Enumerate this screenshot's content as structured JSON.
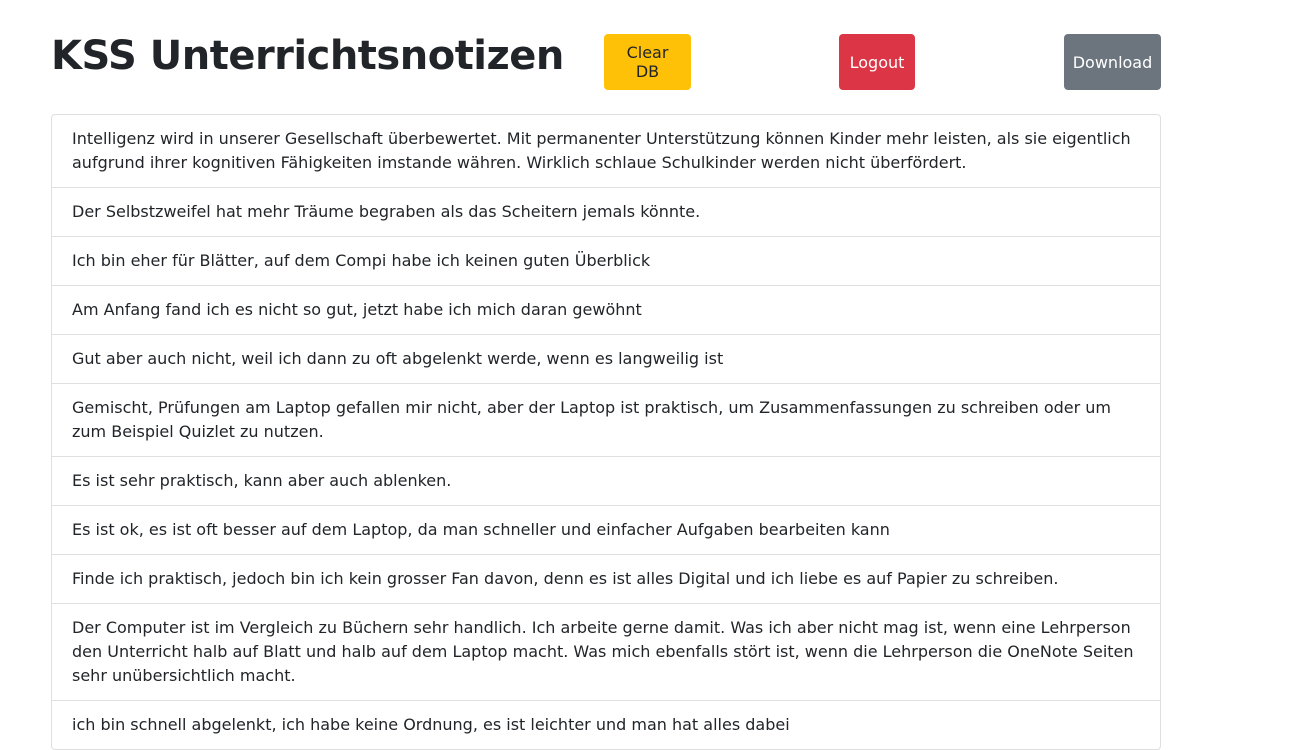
{
  "header": {
    "title": "KSS Unterrichtsnotizen",
    "clear_label": "Clear DB",
    "logout_label": "Logout",
    "download_label": "Download"
  },
  "colors": {
    "warning": "#ffc107",
    "danger": "#dc3545",
    "secondary": "#6c757d"
  },
  "notes": [
    "Intelligenz wird in unserer Gesellschaft überbewertet. Mit permanenter Unterstützung können Kinder mehr leisten, als sie eigentlich aufgrund ihrer kognitiven Fähigkeiten imstande währen. Wirklich schlaue Schulkinder werden nicht überfördert.",
    "Der Selbstzweifel hat mehr Träume begraben als das Scheitern jemals könnte.",
    "Ich bin eher für Blätter, auf dem Compi habe ich keinen guten Überblick",
    "Am Anfang fand ich es nicht so gut, jetzt habe ich mich daran gewöhnt",
    "Gut aber auch nicht, weil ich dann zu oft abgelenkt werde, wenn es langweilig ist",
    "Gemischt, Prüfungen am Laptop gefallen mir nicht, aber der Laptop ist praktisch, um Zusammenfassungen zu schreiben oder um zum Beispiel Quizlet zu nutzen.",
    "Es ist sehr praktisch, kann aber auch ablenken.",
    "Es ist ok, es ist oft besser auf dem Laptop, da man schneller und einfacher Aufgaben bearbeiten kann",
    "Finde ich praktisch, jedoch bin ich kein grosser Fan davon, denn es ist alles Digital und ich liebe es auf Papier zu schreiben.",
    "Der Computer ist im Vergleich zu Büchern sehr handlich. Ich arbeite gerne damit. Was ich aber nicht mag ist, wenn eine Lehrperson den Unterricht halb auf Blatt und halb auf dem Laptop macht. Was mich ebenfalls stört ist, wenn die Lehrperson die OneNote Seiten sehr unübersichtlich macht.",
    "ich bin schnell abgelenkt, ich habe keine Ordnung, es ist leichter und man hat alles dabei"
  ]
}
